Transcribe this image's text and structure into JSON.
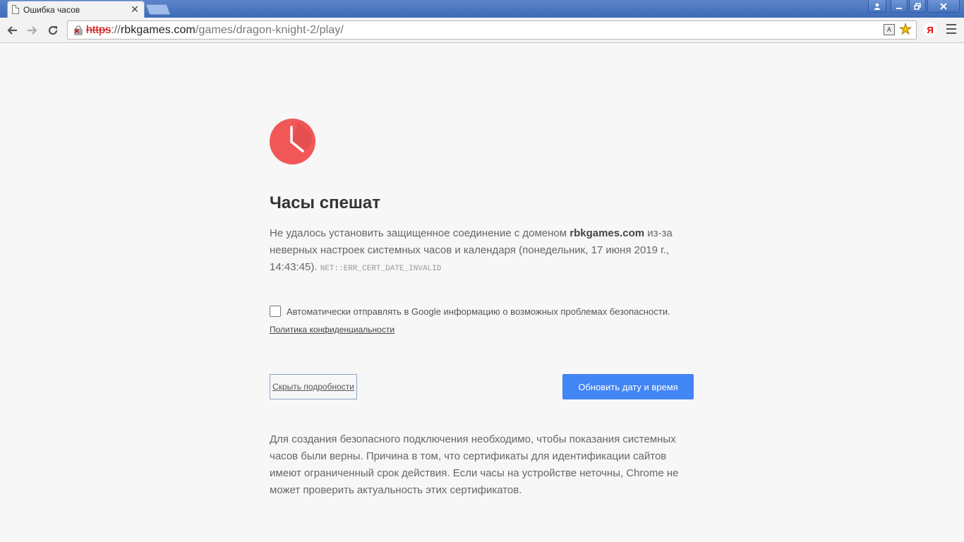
{
  "tab": {
    "title": "Ошибка часов"
  },
  "window": {
    "close_glyph": "x",
    "min_glyph": "–",
    "max_glyph": "⧉"
  },
  "toolbar": {
    "url_scheme": "https",
    "url_sep": "://",
    "url_host": "rbkgames.com",
    "url_path": "/games/dragon-knight-2/play/",
    "yandex_label": "Я"
  },
  "error": {
    "title": "Часы спешат",
    "desc_prefix": "Не удалось установить защищенное соединение с доменом ",
    "domain": "rbkgames.com",
    "desc_suffix": " из-за неверных настроек системных часов и календаря (понедельник, 17 июня 2019 г., 14:43:45). ",
    "code": "NET::ERR_CERT_DATE_INVALID",
    "checkbox_label": "Автоматически отправлять в Google информацию о возможных проблемах безопасности.",
    "privacy_link": "Политика конфиденциальности",
    "details_button": "Скрыть подробности",
    "primary_button": "Обновить дату и время",
    "explanation": "Для создания безопасного подключения необходимо, чтобы показания системных часов были верны. Причина в том, что сертификаты для идентификации сайтов имеют ограниченный срок действия. Если часы на устройстве неточны, Chrome не может проверить актуальность этих сертификатов."
  },
  "colors": {
    "accent": "#4285f4",
    "clock": "#f25757"
  }
}
